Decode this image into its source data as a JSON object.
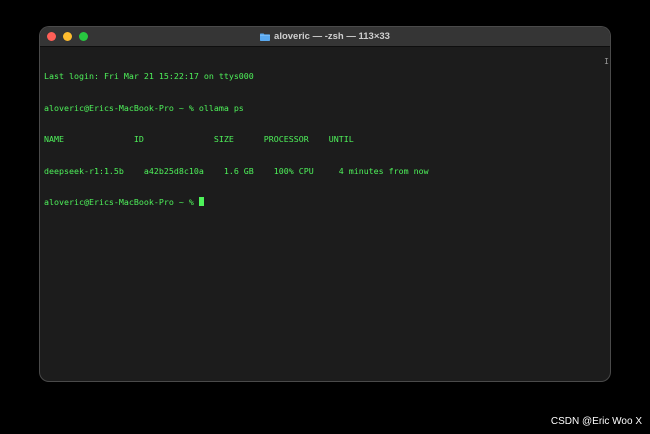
{
  "window": {
    "title": "aloveric — -zsh — 113×33",
    "title_icon": "folder-icon"
  },
  "terminal": {
    "lines": [
      "Last login: Fri Mar 21 15:22:17 on ttys000",
      "aloveric@Erics-MacBook-Pro ~ % ollama ps",
      "NAME              ID              SIZE      PROCESSOR    UNTIL",
      "deepseek-r1:1.5b    a42b25d8c10a    1.6 GB    100% CPU     4 minutes from now"
    ],
    "prompt": "aloveric@Erics-MacBook-Pro ~ % "
  },
  "scroll_marker": "I",
  "watermark": "CSDN @Eric Woo X",
  "colors": {
    "terminal_text": "#4ef25a",
    "terminal_bg": "#1c1c1c",
    "titlebar_bg": "#353535",
    "close": "#ff5f57",
    "minimize": "#febc2e",
    "zoom": "#28c840"
  }
}
